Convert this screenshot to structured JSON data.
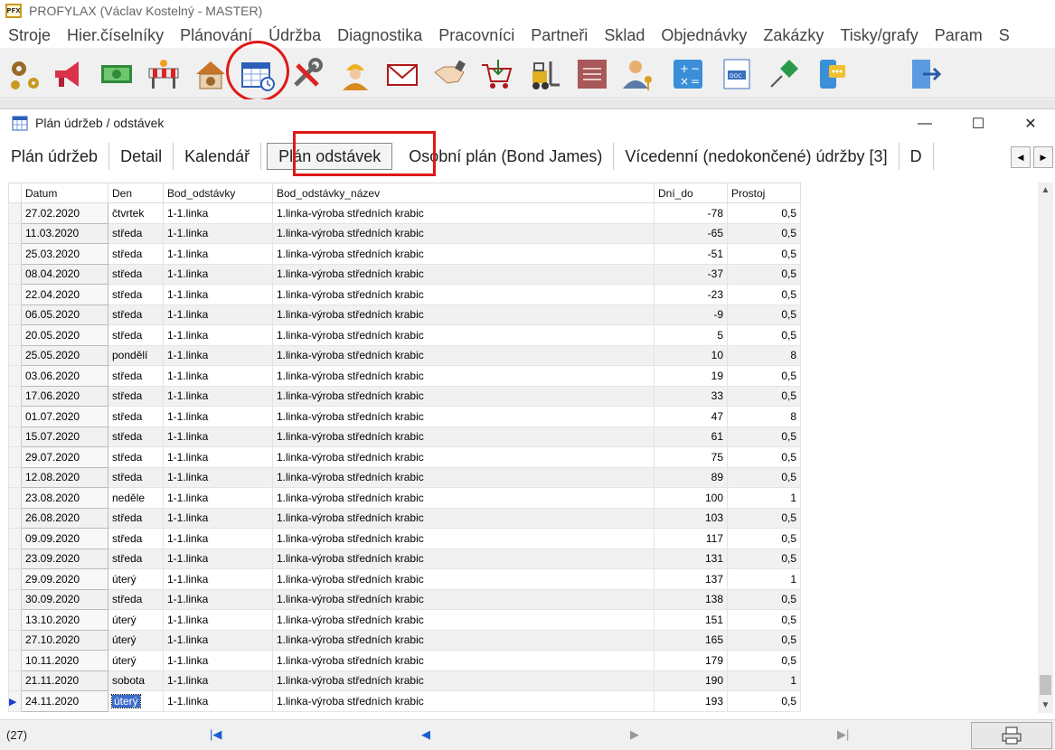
{
  "app": {
    "title": "PROFYLAX (Václav Kostelný - MASTER)",
    "logo_text": "PFX"
  },
  "menu": [
    "Stroje",
    "Hier.číselníky",
    "Plánování",
    "Údržba",
    "Diagnostika",
    "Pracovníci",
    "Partneři",
    "Sklad",
    "Objednávky",
    "Zakázky",
    "Tisky/grafy",
    "Param",
    "S"
  ],
  "toolbar": {
    "icons": [
      "gears-icon",
      "megaphone-icon",
      "money-icon",
      "barrier-icon",
      "house-gear-icon",
      "calendar-clock-icon",
      "tools-icon",
      "worker-icon",
      "envelope-icon",
      "handshake-icon",
      "cart-icon",
      "forklift-icon",
      "ledger-icon",
      "user-key-icon",
      "calculator-icon",
      "doc-icon",
      "pushpin-icon",
      "phone-chat-icon",
      "exit-icon"
    ]
  },
  "window": {
    "title": "Plán údržeb / odstávek"
  },
  "tabs": [
    {
      "label": "Plán údržeb",
      "active": false
    },
    {
      "label": "Detail",
      "active": false
    },
    {
      "label": "Kalendář",
      "active": false
    },
    {
      "label": "Plán odstávek",
      "active": true
    },
    {
      "label": "Osobní plán (Bond James)",
      "active": false
    },
    {
      "label": "Vícedenní (nedokončené) údržby [3]",
      "active": false
    },
    {
      "label": "D",
      "active": false
    }
  ],
  "grid": {
    "columns": [
      "Datum",
      "Den",
      "Bod_odstávky",
      "Bod_odstávky_název",
      "Dní_do",
      "Prostoj"
    ],
    "rows": [
      [
        "27.02.2020",
        "čtvrtek",
        "1-1.linka",
        "1.linka-výroba středních krabic",
        "-78",
        "0,5"
      ],
      [
        "11.03.2020",
        "středa",
        "1-1.linka",
        "1.linka-výroba středních krabic",
        "-65",
        "0,5"
      ],
      [
        "25.03.2020",
        "středa",
        "1-1.linka",
        "1.linka-výroba středních krabic",
        "-51",
        "0,5"
      ],
      [
        "08.04.2020",
        "středa",
        "1-1.linka",
        "1.linka-výroba středních krabic",
        "-37",
        "0,5"
      ],
      [
        "22.04.2020",
        "středa",
        "1-1.linka",
        "1.linka-výroba středních krabic",
        "-23",
        "0,5"
      ],
      [
        "06.05.2020",
        "středa",
        "1-1.linka",
        "1.linka-výroba středních krabic",
        "-9",
        "0,5"
      ],
      [
        "20.05.2020",
        "středa",
        "1-1.linka",
        "1.linka-výroba středních krabic",
        "5",
        "0,5"
      ],
      [
        "25.05.2020",
        "pondělí",
        "1-1.linka",
        "1.linka-výroba středních krabic",
        "10",
        "8"
      ],
      [
        "03.06.2020",
        "středa",
        "1-1.linka",
        "1.linka-výroba středních krabic",
        "19",
        "0,5"
      ],
      [
        "17.06.2020",
        "středa",
        "1-1.linka",
        "1.linka-výroba středních krabic",
        "33",
        "0,5"
      ],
      [
        "01.07.2020",
        "středa",
        "1-1.linka",
        "1.linka-výroba středních krabic",
        "47",
        "8"
      ],
      [
        "15.07.2020",
        "středa",
        "1-1.linka",
        "1.linka-výroba středních krabic",
        "61",
        "0,5"
      ],
      [
        "29.07.2020",
        "středa",
        "1-1.linka",
        "1.linka-výroba středních krabic",
        "75",
        "0,5"
      ],
      [
        "12.08.2020",
        "středa",
        "1-1.linka",
        "1.linka-výroba středních krabic",
        "89",
        "0,5"
      ],
      [
        "23.08.2020",
        "neděle",
        "1-1.linka",
        "1.linka-výroba středních krabic",
        "100",
        "1"
      ],
      [
        "26.08.2020",
        "středa",
        "1-1.linka",
        "1.linka-výroba středních krabic",
        "103",
        "0,5"
      ],
      [
        "09.09.2020",
        "středa",
        "1-1.linka",
        "1.linka-výroba středních krabic",
        "117",
        "0,5"
      ],
      [
        "23.09.2020",
        "středa",
        "1-1.linka",
        "1.linka-výroba středních krabic",
        "131",
        "0,5"
      ],
      [
        "29.09.2020",
        "úterý",
        "1-1.linka",
        "1.linka-výroba středních krabic",
        "137",
        "1"
      ],
      [
        "30.09.2020",
        "středa",
        "1-1.linka",
        "1.linka-výroba středních krabic",
        "138",
        "0,5"
      ],
      [
        "13.10.2020",
        "úterý",
        "1-1.linka",
        "1.linka-výroba středních krabic",
        "151",
        "0,5"
      ],
      [
        "27.10.2020",
        "úterý",
        "1-1.linka",
        "1.linka-výroba středních krabic",
        "165",
        "0,5"
      ],
      [
        "10.11.2020",
        "úterý",
        "1-1.linka",
        "1.linka-výroba středních krabic",
        "179",
        "0,5"
      ],
      [
        "21.11.2020",
        "sobota",
        "1-1.linka",
        "1.linka-výroba středních krabic",
        "190",
        "1"
      ],
      [
        "24.11.2020",
        "úterý",
        "1-1.linka",
        "1.linka-výroba středních krabic",
        "193",
        "0,5"
      ]
    ],
    "current_row": 24
  },
  "status": {
    "record_count": "(27)"
  },
  "colors": {
    "highlight": "#e01818",
    "selection": "#3b6cc8",
    "nav_arrow": "#1a5fd0"
  }
}
